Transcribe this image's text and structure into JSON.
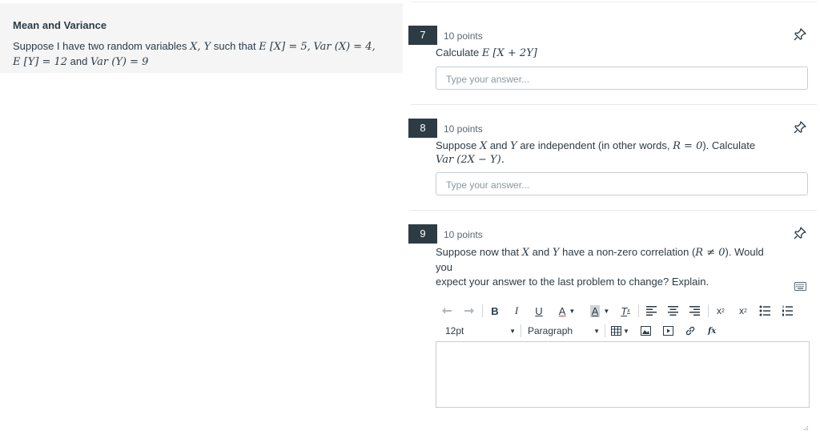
{
  "left": {
    "title": "Mean and Variance",
    "text_prefix": "Suppose I have two random variables ",
    "xy": "X, Y",
    "such_that": " such that ",
    "ex_expr": "E [X] = 5,",
    "varx_expr": "Var (X) = 4,",
    "ey_expr": "E [Y] = 12",
    "and": " and ",
    "vary_expr": "Var (Y) = 9"
  },
  "questions": [
    {
      "number": "7",
      "points": "10 points",
      "text_prefix": "Calculate ",
      "math": "E [X + 2Y]",
      "placeholder": "Type your answer..."
    },
    {
      "number": "8",
      "points": "10 points",
      "text_a": "Suppose ",
      "x": "X",
      "text_b": " and ",
      "y": "Y",
      "text_c": " are independent (in other words, ",
      "r_expr": "R = 0",
      "text_d": "). Calculate",
      "math2": "Var (2X − Y).",
      "placeholder": "Type your answer..."
    },
    {
      "number": "9",
      "points": "10 points",
      "text_a": "Suppose now that ",
      "x": "X",
      "text_b": " and ",
      "y": "Y",
      "text_c": " have a non-zero correlation (",
      "r_expr": "R ≠ 0",
      "text_d": "). Would you",
      "line2": "expect your answer to the last problem to change? Explain."
    }
  ],
  "editor": {
    "font_size": "12pt",
    "block_format": "Paragraph",
    "bold": "B",
    "italic": "I",
    "underline": "U",
    "text_color": "A",
    "bg_color": "A",
    "clear_format": "T",
    "superscript": "x",
    "superscript_mark": "2",
    "subscript": "x",
    "subscript_mark": "2",
    "formula": "fx"
  },
  "icons": {
    "pin": "pin-icon",
    "undo": "undo-icon",
    "redo": "redo-icon",
    "keyboard": "keyboard-icon",
    "align_left": "align-left-icon",
    "align_center": "align-center-icon",
    "align_right": "align-right-icon",
    "bullet_list": "bullet-list-icon",
    "numbered_list": "numbered-list-icon",
    "table": "table-icon",
    "image": "image-icon",
    "media": "media-icon",
    "link": "link-icon"
  },
  "colors": {
    "qnum_bg": "#2d3b45",
    "panel_bg": "#f5f5f5",
    "border": "#c7cdd1",
    "accent_red": "#c23c2d"
  }
}
